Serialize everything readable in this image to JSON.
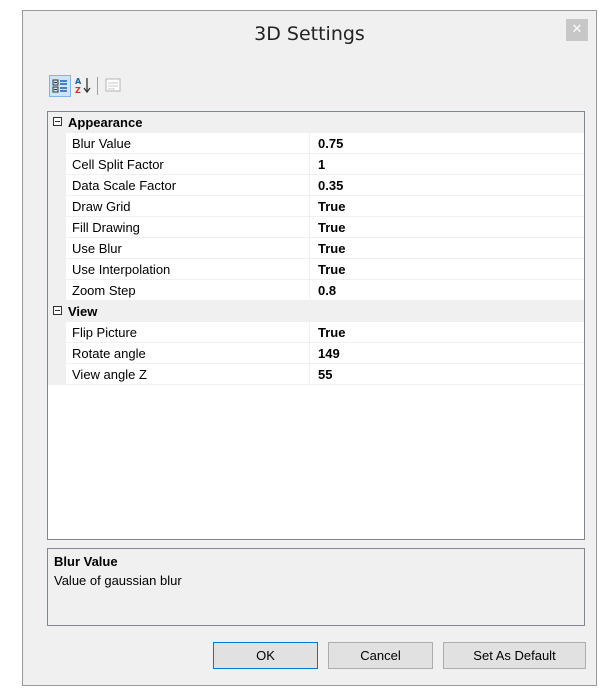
{
  "window": {
    "title": "3D Settings",
    "close_glyph": "✕"
  },
  "toolbar": {
    "buttons": [
      {
        "icon": "categorized-icon",
        "active": true
      },
      {
        "icon": "alphabetical-icon",
        "active": false
      },
      {
        "icon": "property-pages-icon",
        "active": false
      }
    ]
  },
  "grid": {
    "categories": [
      {
        "label": "Appearance",
        "props": [
          {
            "name": "Blur Value",
            "value": "0.75"
          },
          {
            "name": "Cell Split Factor",
            "value": "1"
          },
          {
            "name": "Data Scale Factor",
            "value": "0.35"
          },
          {
            "name": "Draw Grid",
            "value": "True"
          },
          {
            "name": "Fill Drawing",
            "value": "True"
          },
          {
            "name": "Use Blur",
            "value": "True"
          },
          {
            "name": "Use Interpolation",
            "value": "True"
          },
          {
            "name": "Zoom Step",
            "value": "0.8"
          }
        ]
      },
      {
        "label": "View",
        "props": [
          {
            "name": "Flip Picture",
            "value": "True"
          },
          {
            "name": "Rotate angle",
            "value": "149"
          },
          {
            "name": "View angle Z",
            "value": "55"
          }
        ]
      }
    ]
  },
  "description": {
    "title": "Blur Value",
    "text": "Value of gaussian blur"
  },
  "buttons": {
    "ok": "OK",
    "cancel": "Cancel",
    "set_default": "Set As Default"
  },
  "colors": {
    "accent": "#0078d7",
    "toolbar_active_bg": "#cde6f7"
  }
}
